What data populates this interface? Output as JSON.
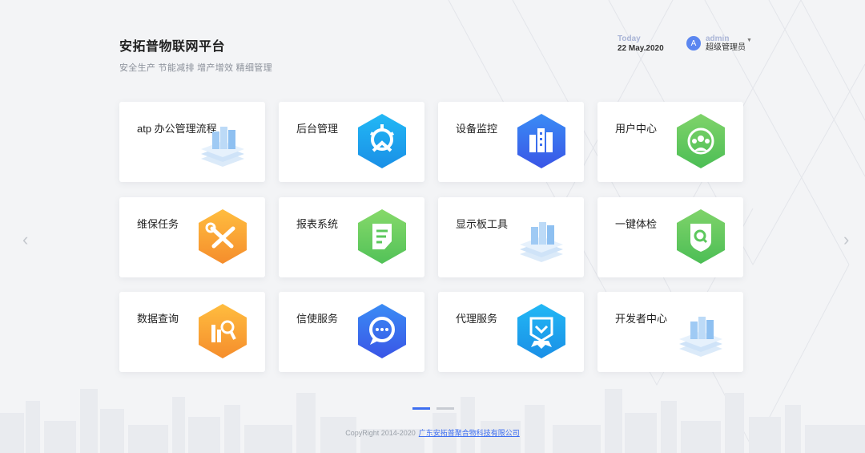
{
  "header": {
    "title": "安拓普物联网平台",
    "subtitle": "安全生产 节能减排 增产增效 精细管理",
    "today_label": "Today",
    "today_date": "22 May.2020",
    "user_initial": "A",
    "user_name": "admin",
    "user_role": "超级管理员"
  },
  "cards": [
    {
      "label": "atp 办公管理流程",
      "icon": "building-stack-icon"
    },
    {
      "label": "后台管理",
      "icon": "gear-hex-icon",
      "color": "#1aa9f0"
    },
    {
      "label": "设备监控",
      "icon": "buildings-hex-icon",
      "color": "#3b6cf0"
    },
    {
      "label": "用户中心",
      "icon": "users-hex-icon",
      "color": "#5cc85c"
    },
    {
      "label": "维保任务",
      "icon": "wrench-hex-icon",
      "color": "#f7a33a"
    },
    {
      "label": "报表系统",
      "icon": "document-hex-icon",
      "color": "#6cce5a"
    },
    {
      "label": "显示板工具",
      "icon": "building-stack-icon"
    },
    {
      "label": "一键体检",
      "icon": "shield-search-hex-icon",
      "color": "#5cc85c"
    },
    {
      "label": "数据查询",
      "icon": "search-data-hex-icon",
      "color": "#f7a33a"
    },
    {
      "label": "信使服务",
      "icon": "chat-hex-icon",
      "color": "#3b6cf0"
    },
    {
      "label": "代理服务",
      "icon": "badge-hex-icon",
      "color": "#1aa9f0"
    },
    {
      "label": "开发者中心",
      "icon": "building-stack-icon"
    }
  ],
  "pagination": {
    "pages": 2,
    "active": 1
  },
  "footer": {
    "copyright": "CopyRight 2014-2020",
    "company": "广东安拓普聚合物科技有限公司"
  }
}
